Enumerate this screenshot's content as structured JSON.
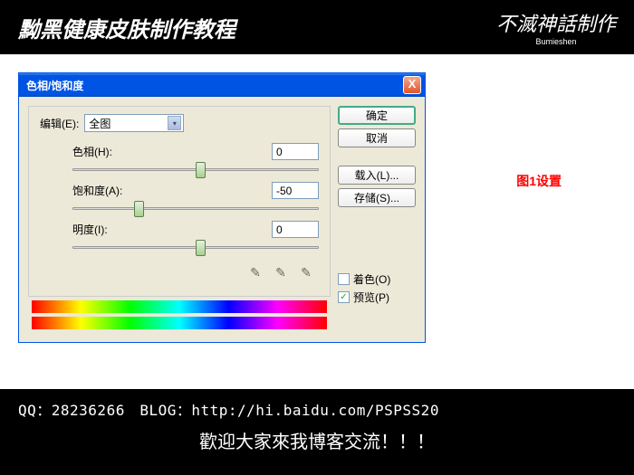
{
  "header": {
    "title": "黝黑健康皮肤制作教程",
    "logo": "不滅神話制作",
    "logo_sub": "Bumieshen"
  },
  "dialog": {
    "title": "色相/饱和度",
    "close": "X",
    "edit_label": "编辑(E):",
    "edit_value": "全图",
    "hue_label": "色相(H):",
    "hue_value": "0",
    "sat_label": "饱和度(A):",
    "sat_value": "-50",
    "light_label": "明度(I):",
    "light_value": "0",
    "ok": "确定",
    "cancel": "取消",
    "load": "载入(L)...",
    "save": "存储(S)...",
    "colorize": "着色(O)",
    "preview": "预览(P)",
    "preview_checked": "✓"
  },
  "annotation": "图1设置",
  "footer": {
    "line1": "QQ：28236266　BLOG：http://hi.baidu.com/PSPSS20",
    "line2": "歡迎大家來我博客交流！！！"
  }
}
